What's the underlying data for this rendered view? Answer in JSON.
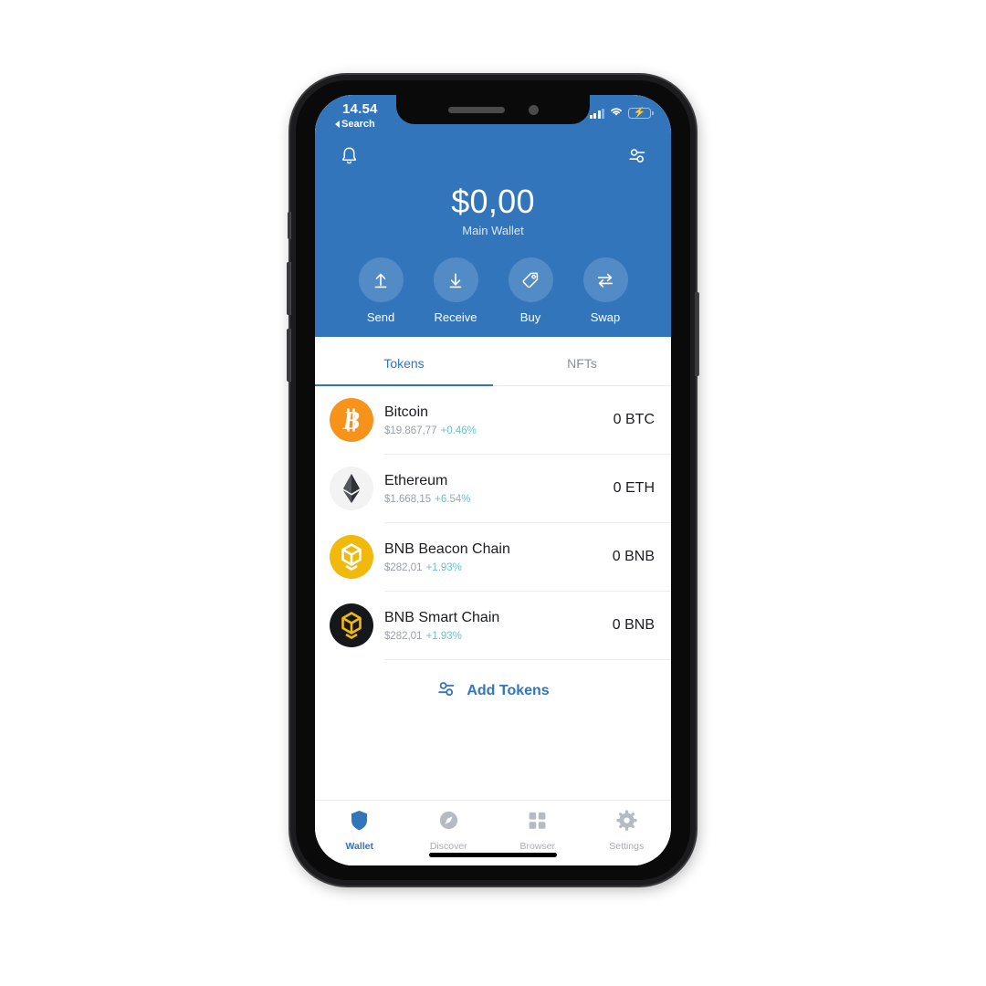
{
  "status_bar": {
    "time": "14.54",
    "back_label": "Search",
    "signal_icon": "cellular-bars-icon",
    "wifi_icon": "wifi-icon",
    "battery_icon": "battery-charging-icon"
  },
  "header": {
    "notifications_icon": "bell-icon",
    "settings_icon": "sliders-icon",
    "balance": "$0,00",
    "wallet_name": "Main Wallet",
    "actions": [
      {
        "label": "Send",
        "icon": "arrow-up-icon"
      },
      {
        "label": "Receive",
        "icon": "arrow-down-icon"
      },
      {
        "label": "Buy",
        "icon": "tag-icon"
      },
      {
        "label": "Swap",
        "icon": "swap-arrows-icon"
      }
    ]
  },
  "tabs": [
    {
      "label": "Tokens",
      "active": true
    },
    {
      "label": "NFTs",
      "active": false
    }
  ],
  "tokens": [
    {
      "name": "Bitcoin",
      "price": "$19.867,77",
      "change": "+0.46%",
      "balance": "0 BTC",
      "icon": "bitcoin-icon"
    },
    {
      "name": "Ethereum",
      "price": "$1.668,15",
      "change": "+6.54%",
      "balance": "0 ETH",
      "icon": "ethereum-icon"
    },
    {
      "name": "BNB Beacon Chain",
      "price": "$282,01",
      "change": "+1.93%",
      "balance": "0 BNB",
      "icon": "bnb-beacon-icon"
    },
    {
      "name": "BNB Smart Chain",
      "price": "$282,01",
      "change": "+1.93%",
      "balance": "0 BNB",
      "icon": "bnb-smart-icon"
    }
  ],
  "add_tokens": {
    "label": "Add Tokens",
    "icon": "sliders-icon"
  },
  "bottom_nav": [
    {
      "label": "Wallet",
      "icon": "shield-icon",
      "active": true
    },
    {
      "label": "Discover",
      "icon": "compass-icon",
      "active": false
    },
    {
      "label": "Browser",
      "icon": "grid-icon",
      "active": false
    },
    {
      "label": "Settings",
      "icon": "gear-icon",
      "active": false
    }
  ],
  "colors": {
    "brand_blue": "#3375BB",
    "change_green": "#6FBFC9",
    "bitcoin_orange": "#F7931A",
    "bnb_yellow": "#F0B90B"
  }
}
